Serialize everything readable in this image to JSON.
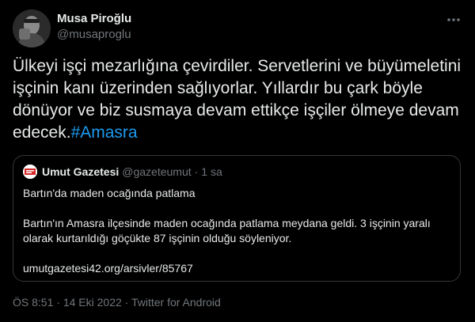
{
  "author": {
    "display_name": "Musa Piroğlu",
    "handle": "@musaproglu"
  },
  "more_icon": "more-horizontal-icon",
  "tweet": {
    "text": "Ülkeyi işçi mezarlığına çevirdiler. Servetlerini ve büyümeletini işçinin kanı üzerinden sağlıyorlar. Yıllardır bu çark böyle dönüyor ve biz susmaya devam ettikçe işçiler ölmeye devam edecek.",
    "hashtag": "#Amasra"
  },
  "quote": {
    "name": "Umut Gazetesi",
    "handle": "@gazeteumut",
    "dot": "·",
    "time": "1 sa",
    "headline": "Bartın'da maden ocağında patlama",
    "body": "Bartın'ın Amasra ilçesinde maden ocağında patlama meydana geldi. 3 işçinin yaralı olarak kurtarıldığı göçükte 87 işçinin olduğu söyleniyor.",
    "link": "umutgazetesi42.org/arsivler/85767"
  },
  "meta": {
    "time": "ÖS 8:51",
    "sep1": "·",
    "date": "14 Eki 2022",
    "sep2": "·",
    "source": "Twitter for Android"
  },
  "colors": {
    "background": "#000000",
    "text": "#e7e9ea",
    "secondary": "#71767b",
    "link": "#1d9bf0",
    "border": "#333639"
  }
}
